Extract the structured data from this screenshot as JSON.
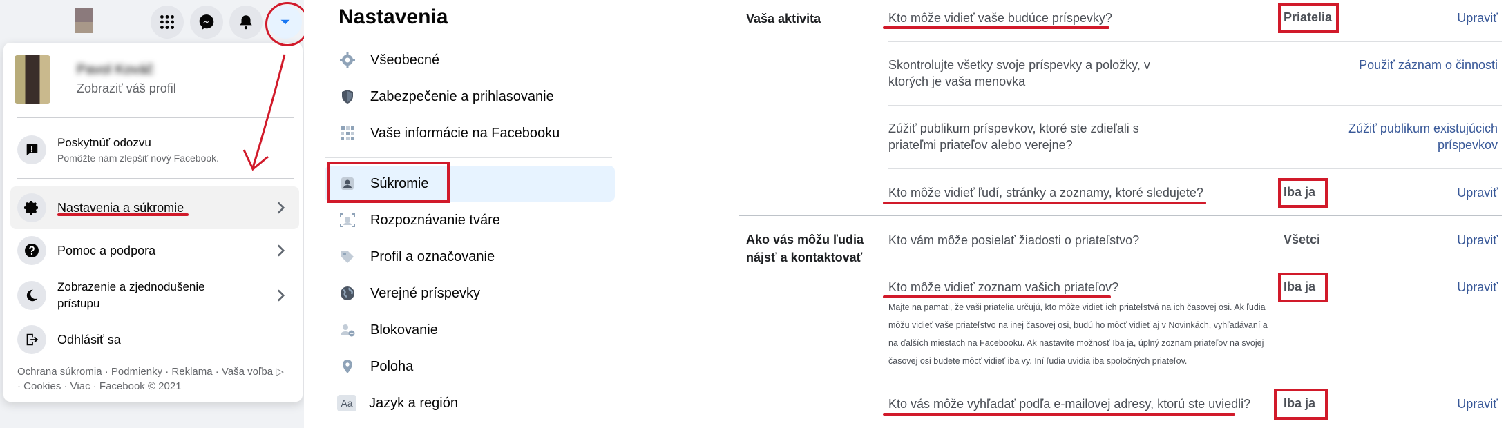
{
  "dropdown": {
    "profile": {
      "name": "Pavol Kováč",
      "subtitle": "Zobraziť váš profil"
    },
    "feedback": {
      "title": "Poskytnúť odozvu",
      "subtitle": "Pomôžte nám zlepšiť nový Facebook."
    },
    "items": [
      {
        "label": "Nastavenia a súkromie"
      },
      {
        "label": "Pomoc a podpora"
      },
      {
        "label_line1": "Zobrazenie a zjednodušenie",
        "label_line2": "prístupu"
      },
      {
        "label": "Odhlásiť sa"
      }
    ],
    "footer_line1": "Ochrana súkromia · Podmienky · Reklama · Vaša voľba ▷",
    "footer_line2": "· Cookies · Viac · Facebook © 2021",
    "top_icons": [
      "grid-menu-icon",
      "messenger-icon",
      "bell-icon",
      "caret-down-icon"
    ]
  },
  "settings_nav": {
    "title": "Nastavenia",
    "items": [
      {
        "label": "Všeobecné",
        "icon": "gear-icon"
      },
      {
        "label": "Zabezpečenie a prihlasovanie",
        "icon": "shield-icon"
      },
      {
        "label": "Vaše informácie na Facebooku",
        "icon": "grid-icon"
      },
      {
        "label": "Súkromie",
        "icon": "lock-person-icon",
        "selected": true
      },
      {
        "label": "Rozpoznávanie tváre",
        "icon": "face-scan-icon"
      },
      {
        "label": "Profil a označovanie",
        "icon": "tag-icon"
      },
      {
        "label": "Verejné príspevky",
        "icon": "globe-icon"
      },
      {
        "label": "Blokovanie",
        "icon": "block-user-icon"
      },
      {
        "label": "Poloha",
        "icon": "location-pin-icon"
      },
      {
        "label": "Jazyk a región",
        "icon": "language-icon",
        "icon_text": "Aa"
      }
    ]
  },
  "privacy": {
    "sections": [
      {
        "title": "Vaša aktivita",
        "rows": [
          {
            "question": "Kto môže vidieť vaše budúce príspevky?",
            "value": "Priatelia",
            "action": "Upraviť"
          },
          {
            "question_line1": "Skontrolujte všetky svoje príspevky a položky, v",
            "question_line2": "ktorých je vaša menovka",
            "action": "Použiť záznam o činnosti"
          },
          {
            "question_line1": "Zúžiť publikum príspevkov, ktoré ste zdieľali s",
            "question_line2": "priateľmi priateľov alebo verejne?",
            "action_line1": "Zúžiť publikum existujúcich",
            "action_line2": "príspevkov"
          },
          {
            "question": "Kto môže vidieť ľudí, stránky a zoznamy, ktoré sledujete?",
            "value": "Iba ja",
            "action": "Upraviť"
          }
        ]
      },
      {
        "title_line1": "Ako vás môžu ľudia",
        "title_line2": "nájsť a kontaktovať",
        "rows": [
          {
            "question": "Kto vám môže posielať žiadosti o priateľstvo?",
            "value": "Všetci",
            "action": "Upraviť"
          },
          {
            "question": "Kto môže vidieť zoznam vašich priateľov?",
            "value": "Iba ja",
            "action": "Upraviť",
            "description_lines": [
              "Majte na pamäti, že vaši priatelia určujú, kto môže vidieť ich priateľstvá na ich časovej osi. Ak ľudia",
              "môžu vidieť vaše priateľstvo na inej časovej osi, budú ho môcť vidieť aj v Novinkách, vyhľadávaní a",
              "na ďalších miestach na Facebooku. Ak nastavíte možnosť Iba ja, úplný zoznam priateľov na svojej",
              "časovej osi budete môcť vidieť iba vy. Iní ľudia uvidia iba spoločných priateľov."
            ]
          },
          {
            "question": "Kto vás môže vyhľadať podľa e-mailovej adresy, ktorú ste uviedli?",
            "value": "Iba ja",
            "action": "Upraviť"
          }
        ]
      }
    ]
  },
  "colors": {
    "accent": "#1877f2",
    "link": "#385898",
    "annotation": "#d11a2a",
    "selected_bg": "#e7f3ff"
  }
}
